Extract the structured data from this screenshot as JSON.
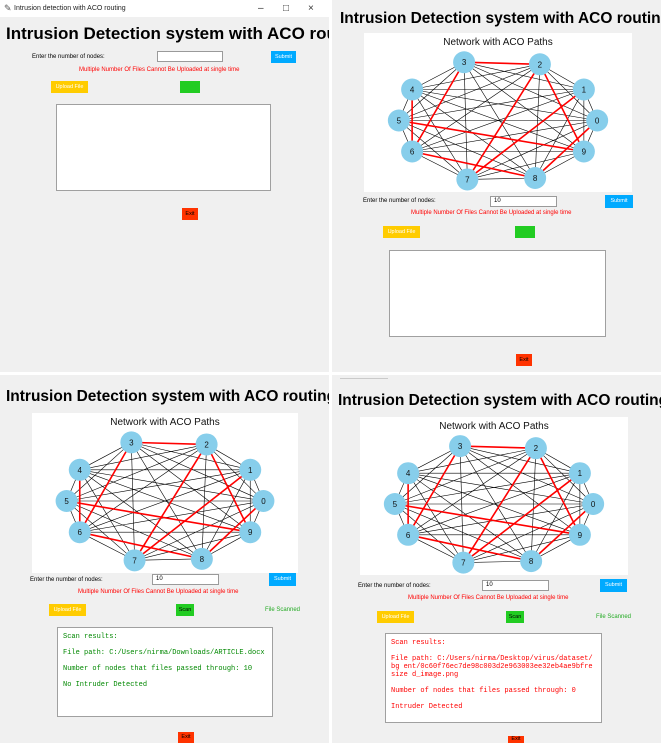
{
  "window": {
    "title": "Intrusion detection with ACO routing"
  },
  "app_title": "Intrusion Detection system with ACO routing",
  "graph_title": "Network with ACO Paths",
  "labels": {
    "nodes_prompt": "Enter the number of nodes:",
    "warning": "Multiple Number Of Files Cannot Be Uploaded at single time",
    "file_scanned": "File Scanned"
  },
  "buttons": {
    "submit": "Submit",
    "upload": "Upload File",
    "scan": "Scan",
    "exit": "Exit"
  },
  "panels": [
    {
      "nodes_value": "",
      "results": []
    },
    {
      "nodes_value": "10",
      "results": []
    },
    {
      "nodes_value": "10",
      "result_color": "#008800",
      "results": [
        "Scan results:",
        "File path: C:/Users/nirma/Downloads/ARTICLE.docx",
        "Number of nodes that files passed through:  10",
        "No Intruder Detected"
      ]
    },
    {
      "nodes_value": "10",
      "result_color": "#ff0000",
      "results": [
        "Scan results:",
        "File path: C:/Users/nirma/Desktop/virus/dataset/bg ent/0c60f76ec7de98c003d2e963003ee32eb4ae9bfresize d_image.png",
        "Number of nodes that files passed through: 0",
        "Intruder Detected"
      ]
    }
  ],
  "graph": {
    "nodes": [
      "0",
      "1",
      "2",
      "3",
      "4",
      "5",
      "6",
      "7",
      "8",
      "9"
    ],
    "node_color": "#87ceeb",
    "edge_color": "#000000",
    "aco_path_color": "#ff0000",
    "aco_edges": [
      [
        "3",
        "2"
      ],
      [
        "2",
        "7"
      ],
      [
        "7",
        "1"
      ],
      [
        "4",
        "6"
      ],
      [
        "6",
        "8"
      ],
      [
        "8",
        "0"
      ],
      [
        "5",
        "9"
      ],
      [
        "3",
        "6"
      ],
      [
        "2",
        "9"
      ]
    ]
  }
}
